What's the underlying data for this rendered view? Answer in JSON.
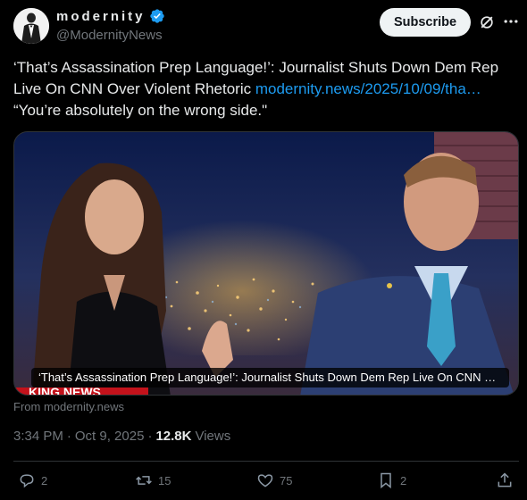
{
  "author": {
    "display_name": "modernity",
    "handle": "@ModernityNews",
    "verified": true,
    "avatar_icon": "tuxedo-figure-avatar"
  },
  "header": {
    "subscribe_label": "Subscribe",
    "grok_icon": "grok-icon",
    "more_icon": "more-icon"
  },
  "tweet": {
    "text": "‘That’s Assassination Prep Language!’: Journalist Shuts Down Dem Rep Live On CNN Over Violent Rhetoric ",
    "link_text": "modernity.news/2025/10/09/tha…",
    "quote": "“You’re absolutely on the wrong side.\""
  },
  "media": {
    "caption": "‘That’s Assassination Prep Language!’: Journalist Shuts Down Dem Rep Live On CNN O…",
    "chyron_text": "KING NEWS"
  },
  "card_source": "From modernity.news",
  "meta": {
    "time": "3:34 PM",
    "date": "Oct 9, 2025",
    "views_count": "12.8K",
    "views_label": "Views"
  },
  "actions": {
    "replies": "2",
    "reposts": "15",
    "likes": "75",
    "bookmarks": "2"
  },
  "colors": {
    "background": "#000000",
    "link": "#1d9bf0",
    "verified": "#1d9bf0",
    "muted": "#71767b"
  }
}
